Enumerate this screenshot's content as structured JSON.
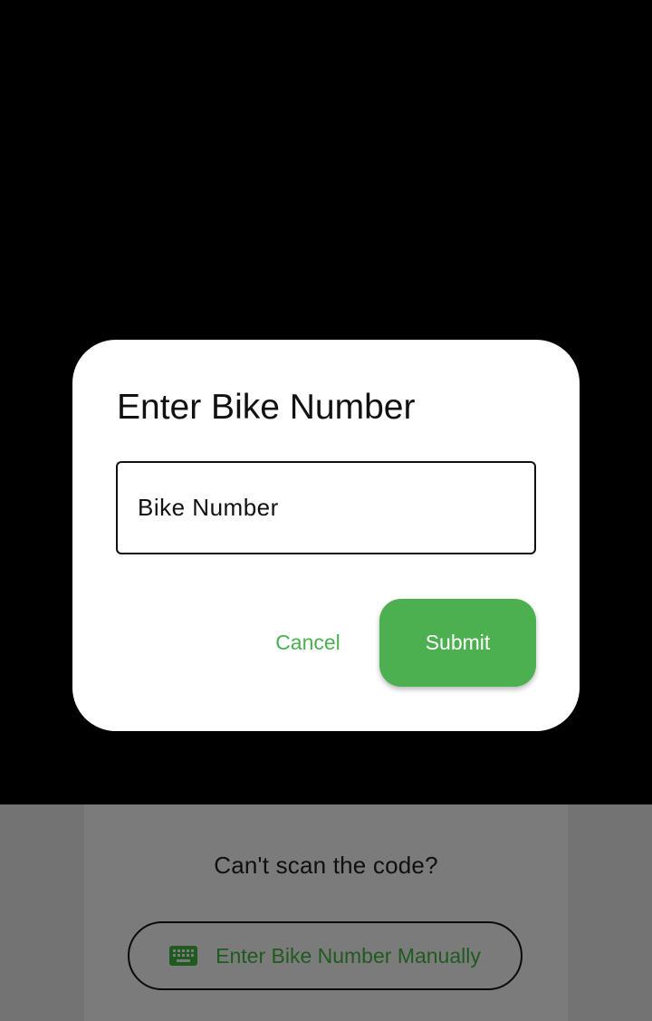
{
  "dialog": {
    "title": "Enter Bike Number",
    "input_placeholder": "Bike Number",
    "input_value": "",
    "cancel_label": "Cancel",
    "submit_label": "Submit"
  },
  "bottom_panel": {
    "prompt_text": "Can't scan the code?",
    "manual_button_label": "Enter Bike Number Manually",
    "manual_button_icon": "keyboard-icon"
  },
  "colors": {
    "accent": "#4caf50",
    "manual_text": "#1f5a1f",
    "scrim_panel": "#737373",
    "dialog_bg": "#ffffff",
    "camera_bg": "#000000"
  }
}
